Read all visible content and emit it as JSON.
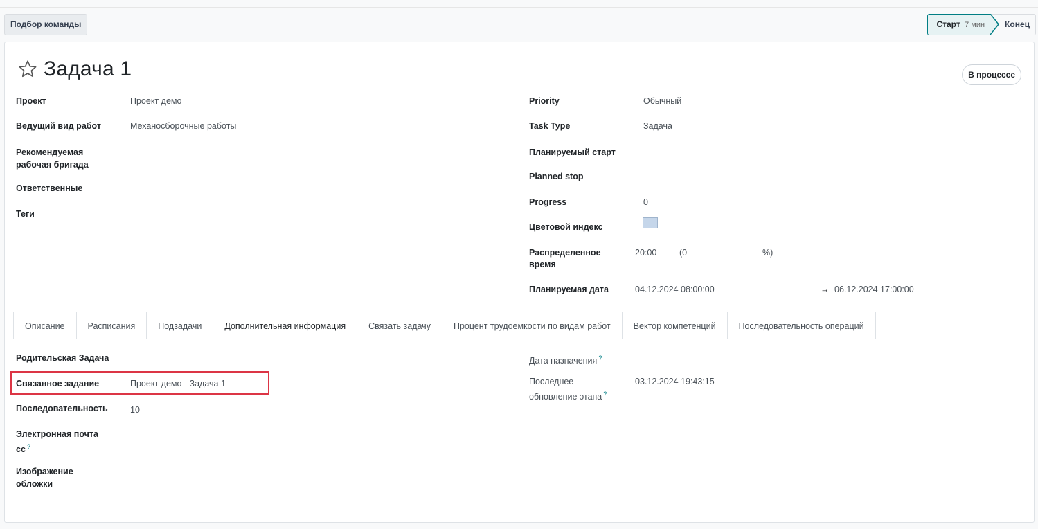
{
  "control": {
    "team_button": "Подбор команды",
    "stage_start": "Старт",
    "stage_duration": "7 мин",
    "stage_end": "Конец"
  },
  "record": {
    "title": "Задача 1",
    "status": "В процессе"
  },
  "left_fields": {
    "project_label": "Проект",
    "project_value": "Проект демо",
    "work_type_label": "Ведущий вид работ",
    "work_type_value": "Механосборочные работы",
    "crew_label_line1": "Рекомендуемая",
    "crew_label_line2": "рабочая бригада",
    "responsible_label": "Ответственные",
    "tags_label": "Теги"
  },
  "right_fields": {
    "priority_label": "Priority",
    "priority_value": "Обычный",
    "task_type_label": "Task Type",
    "task_type_value": "Задача",
    "planned_start_label": "Планируемый старт",
    "planned_stop_label": "Planned stop",
    "progress_label": "Progress",
    "progress_value": "0",
    "color_label": "Цветовой индекс",
    "color_value": "#c5d6ea",
    "allocated_label_line1": "Распределенное",
    "allocated_label_line2": "время",
    "allocated_value": "20:00",
    "allocated_pct_open": "(0",
    "allocated_pct_close": "%)",
    "planned_date_label": "Планируемая дата",
    "planned_date_from": "04.12.2024 08:00:00",
    "planned_date_arrow": "→",
    "planned_date_to": "06.12.2024 17:00:00"
  },
  "tabs": [
    {
      "label": "Описание"
    },
    {
      "label": "Расписания"
    },
    {
      "label": "Подзадачи"
    },
    {
      "label": "Дополнительная информация"
    },
    {
      "label": "Связать задачу"
    },
    {
      "label": "Процент трудоемкости по видам работ"
    },
    {
      "label": "Вектор компетенций"
    },
    {
      "label": "Последовательность операций"
    }
  ],
  "extra_info": {
    "parent_label": "Родительская Задача",
    "linked_label": "Связанное задание",
    "linked_value": "Проект демо - Задача 1",
    "sequence_label": "Последовательность",
    "sequence_value": "10",
    "email_cc_line1": "Электронная почта",
    "email_cc_line2": "cc",
    "cover_line1": "Изображение",
    "cover_line2": "обложки",
    "assign_date_label": "Дата назначения",
    "last_stage_line1": "Последнее",
    "last_stage_line2": "обновление этапа",
    "last_stage_value": "03.12.2024 19:43:15",
    "help_mark": "?"
  }
}
